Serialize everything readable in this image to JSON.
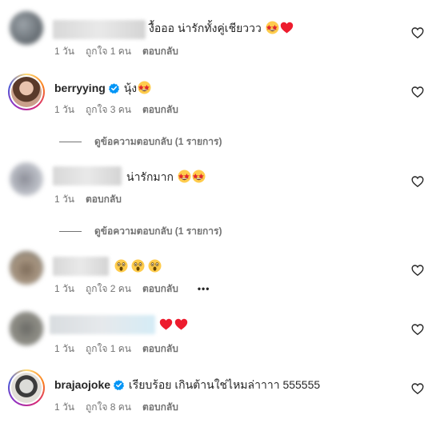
{
  "comments": [
    {
      "text": "งื้อออ น่ารักทั้งคู่เชียววว",
      "time": "1 วัน",
      "likes": "ถูกใจ 1 คน",
      "reply": "ตอบกลับ",
      "emojis": [
        "star-struck-face",
        "red-heart"
      ]
    },
    {
      "username": "berryying",
      "text": "นุ้ง",
      "time": "1 วัน",
      "likes": "ถูกใจ 3 คน",
      "reply": "ตอบกลับ",
      "view_replies": "ดูข้อความตอบกลับ (1 รายการ)",
      "emojis": [
        "star-struck-face"
      ]
    },
    {
      "text": "น่ารักมาก",
      "time": "1 วัน",
      "reply": "ตอบกลับ",
      "view_replies": "ดูข้อความตอบกลับ (1 รายการ)",
      "emojis": [
        "star-struck-face",
        "star-struck-face"
      ]
    },
    {
      "time": "1 วัน",
      "likes": "ถูกใจ 2 คน",
      "reply": "ตอบกลับ",
      "more": "•••",
      "emojis": [
        "astonished-face",
        "astonished-face",
        "astonished-face"
      ]
    },
    {
      "time": "1 วัน",
      "likes": "ถูกใจ 1 คน",
      "reply": "ตอบกลับ",
      "emojis": [
        "red-heart",
        "red-heart"
      ]
    },
    {
      "username": "brajaojoke",
      "text": "เรียบร้อย เกินต้านใช่ไหมล่าาาา 555555",
      "time": "1 วัน",
      "likes": "ถูกใจ 8 คน",
      "reply": "ตอบกลับ"
    }
  ],
  "colors": {
    "text": "#262626",
    "secondary": "#737373",
    "verified": "#0095f6",
    "heart": "#ed1c2e"
  }
}
